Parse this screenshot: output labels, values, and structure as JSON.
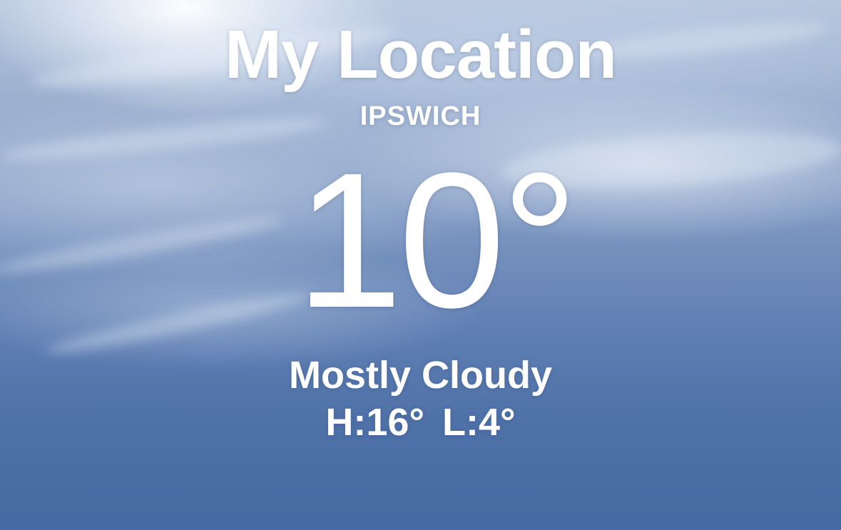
{
  "location": {
    "title": "My Location",
    "city": "IPSWICH"
  },
  "weather": {
    "temperature": "10°",
    "condition": "Mostly Cloudy",
    "high_low": "H:16°  L:4°"
  },
  "colors": {
    "sky_top": "#b7c6dd",
    "sky_bottom": "#456aa3",
    "text": "#ffffff"
  }
}
